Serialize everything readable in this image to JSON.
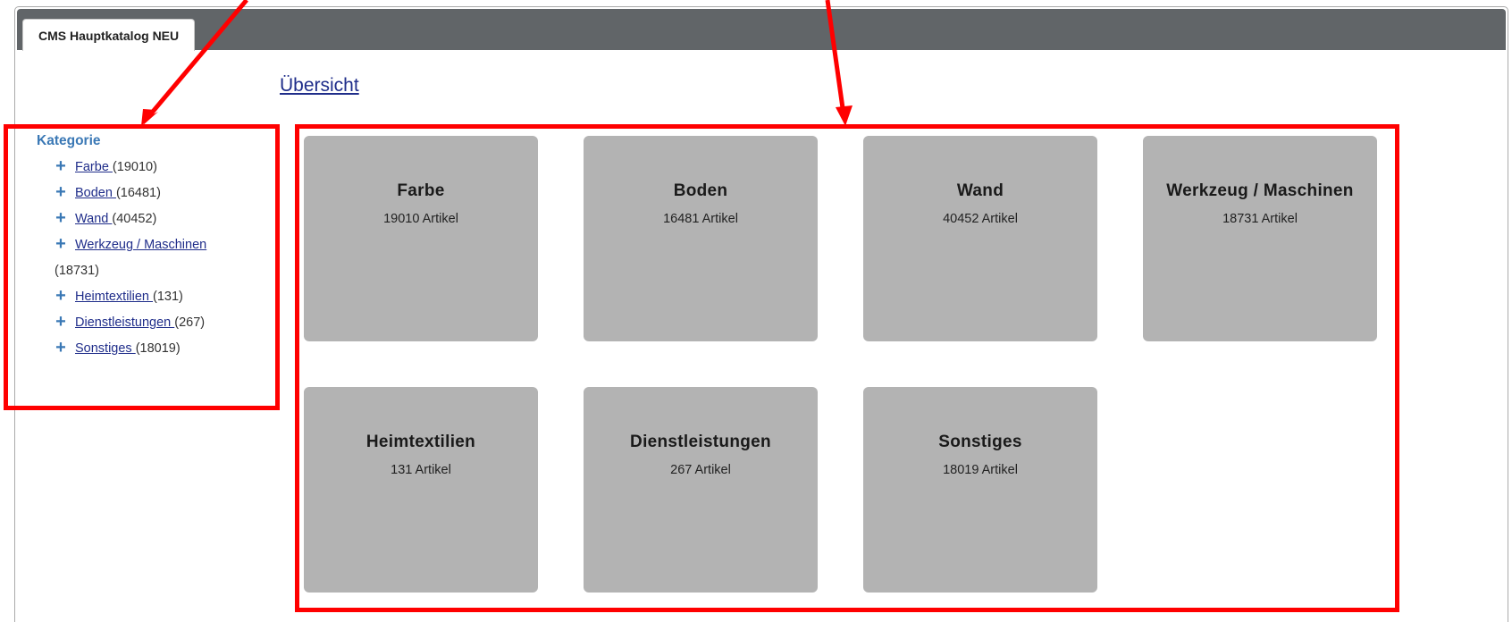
{
  "tab": {
    "label": "CMS Hauptkatalog NEU"
  },
  "overview": {
    "label": "Übersicht"
  },
  "sidebar": {
    "title": "Kategorie",
    "items": [
      {
        "label": "Farbe ",
        "count": "(19010)"
      },
      {
        "label": "Boden ",
        "count": "(16481)"
      },
      {
        "label": "Wand ",
        "count": "(40452)"
      },
      {
        "label": "Werkzeug / Maschinen",
        "count": "(18731)"
      },
      {
        "label": "Heimtextilien ",
        "count": "(131)"
      },
      {
        "label": "Dienstleistungen ",
        "count": "(267)"
      },
      {
        "label": "Sonstiges ",
        "count": "(18019)"
      }
    ]
  },
  "tiles": [
    {
      "title": "Farbe",
      "count": "19010 Artikel"
    },
    {
      "title": "Boden",
      "count": "16481 Artikel"
    },
    {
      "title": "Wand",
      "count": "40452 Artikel"
    },
    {
      "title": "Werkzeug / Maschinen",
      "count": "18731 Artikel"
    },
    {
      "title": "Heimtextilien",
      "count": "131 Artikel"
    },
    {
      "title": "Dienstleistungen",
      "count": "267 Artikel"
    },
    {
      "title": "Sonstiges",
      "count": "18019 Artikel"
    }
  ],
  "colors": {
    "tabbar": "#616568",
    "tile": "#b3b3b3",
    "link": "#1f2d8a",
    "sidebar_accent": "#3a78b5",
    "annotation": "#ff0000"
  },
  "icons": {
    "expand": "plus-icon"
  }
}
